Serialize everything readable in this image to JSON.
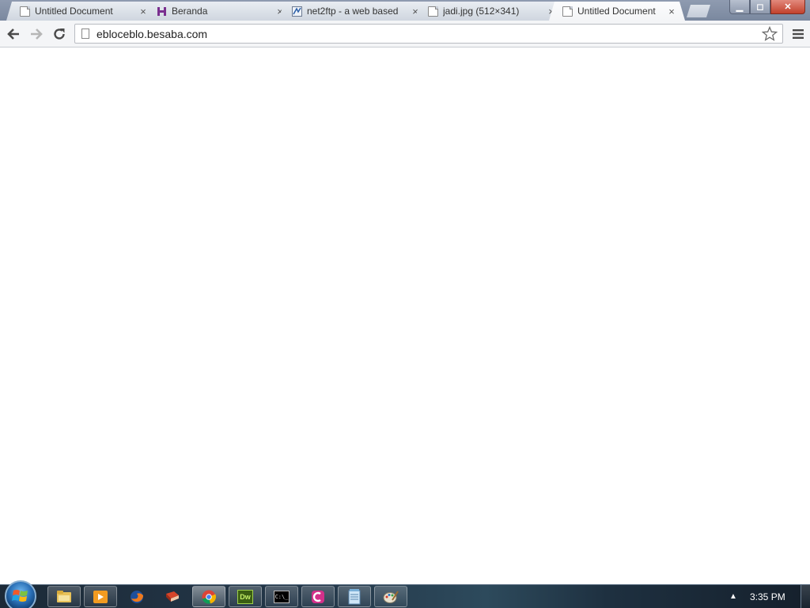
{
  "browser": {
    "tabs": [
      {
        "title": "Untitled Document",
        "favicon": "document-icon"
      },
      {
        "title": "Beranda",
        "favicon": "wordpress-h-icon"
      },
      {
        "title": "net2ftp - a web based",
        "favicon": "net2ftp-icon"
      },
      {
        "title": "jadi.jpg (512×341)",
        "favicon": "document-icon"
      },
      {
        "title": "Untitled Document",
        "favicon": "document-icon",
        "active": true
      }
    ],
    "close_glyph": "×",
    "address": "ebloceblo.besaba.com",
    "colors": {
      "tabstrip": "#8f9bb0",
      "toolbar": "#f4f5f7",
      "close_button": "#c2412c"
    }
  },
  "window_controls": {
    "minimize": "▁",
    "maximize": "◻",
    "close": "✕"
  },
  "taskbar": {
    "start_icon": "windows-start-orb-icon",
    "apps": [
      "file-explorer-icon",
      "media-player-icon",
      "firefox-icon",
      "red-book-app-icon",
      "chrome-icon",
      "dreamweaver-icon",
      "command-prompt-icon",
      "pink-app-icon",
      "notepad-icon",
      "paint-icon"
    ],
    "dreamweaver_label": "Dw",
    "cmd_label": "C:\\_",
    "tray_arrow": "▲",
    "clock": "3:35 PM"
  }
}
